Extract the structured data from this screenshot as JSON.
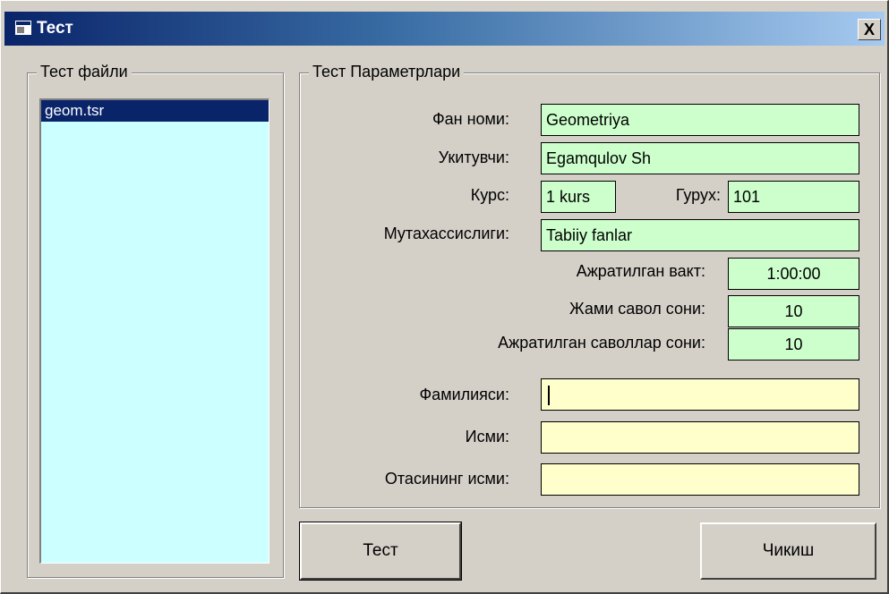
{
  "window": {
    "title": "Тест",
    "close_label": "X",
    "icon": "app-window-icon"
  },
  "files_group": {
    "label": "Тест файли",
    "items": [
      {
        "label": "geom.tsr",
        "selected": true
      }
    ]
  },
  "params_group": {
    "label": "Тест Параметрлари",
    "subject": {
      "label": "Фан номи:",
      "value": "Geometriya"
    },
    "teacher": {
      "label": "Укитувчи:",
      "value": "Egamqulov Sh"
    },
    "course": {
      "label": "Курс:",
      "value": "1 kurs"
    },
    "group": {
      "label": "Гурух:",
      "value": "101"
    },
    "specialty": {
      "label": "Мутахассислиги:",
      "value": "Tabiiy fanlar"
    },
    "allotted_time": {
      "label": "Ажратилган вакт:",
      "value": "1:00:00"
    },
    "total_questions": {
      "label": "Жами савол сони:",
      "value": "10"
    },
    "selected_questions": {
      "label": "Ажратилган саволлар сони:",
      "value": "10"
    },
    "last_name": {
      "label": "Фамилияси:",
      "value": ""
    },
    "first_name": {
      "label": "Исми:",
      "value": ""
    },
    "patronymic": {
      "label": "Отасининг исми:",
      "value": ""
    }
  },
  "buttons": {
    "test": "Тест",
    "exit": "Чикиш"
  },
  "colors": {
    "readonly_field": "#ccffcc",
    "input_field": "#ffffcc",
    "listbox": "#ccffff",
    "selection": "#0a246a"
  }
}
